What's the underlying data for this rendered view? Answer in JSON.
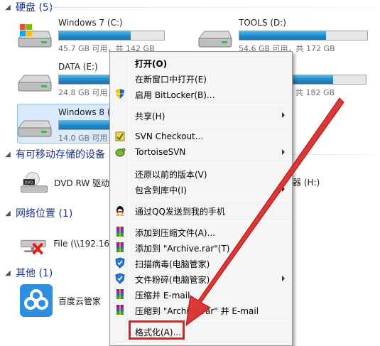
{
  "groups": {
    "hard_disks": "硬盘 (5)",
    "removable": "有可移动存储的设备",
    "network": "网络位置 (1)",
    "other": "其他 (1)"
  },
  "drives": [
    {
      "name": "Windows 7 (C:)",
      "free": "45.7 GB 可用，共 142 GB",
      "used_fraction": 0.68
    },
    {
      "name": "TOOLS (D:)",
      "free": "54.6 GB 可用，共 172 GB",
      "used_fraction": 0.68
    },
    {
      "name": "DATA (E:)",
      "free": "24.8 GB 可用，",
      "used_fraction": 0.85
    },
    {
      "name": "",
      "free": "共 182 GB",
      "used_fraction": 0.85
    },
    {
      "name": "Windows 8 (",
      "free": "14.0 GB 可用",
      "used_fraction": 0.9
    }
  ],
  "removable_items": {
    "dvd": "DVD RW 驱动",
    "h_drive": "器 (H:)"
  },
  "network_items": {
    "file": "File (\\\\192.16"
  },
  "other_items": {
    "baidu": "百度云管家"
  },
  "menu": {
    "open": "打开(O)",
    "open_new_window": "在新窗口中打开(E)",
    "bitlocker": "启用 BitLocker(B)...",
    "share": "共享(H)",
    "svn_checkout": "SVN Checkout...",
    "tortoise": "TortoiseSVN",
    "restore": "还原以前的版本(V)",
    "include_library": "包含到库中(I)",
    "qq_send": "通过QQ发送到我的手机",
    "add_archive": "添加到压缩文件(A)...",
    "add_rar": "添加到 \"Archive.rar\"(T)",
    "scan_virus": "扫描病毒(电脑管家)",
    "shred": "文件粉碎(电脑管家)",
    "compress_email": "压缩并 E-mail",
    "compress_rar_email": "压缩到 \"Archive.rar\" 并 E-mail",
    "format": "格式化(A)..."
  },
  "colors": {
    "accent_red": "#e0201f",
    "bar_blue": "#2188c8",
    "group_header": "#1e3287"
  }
}
